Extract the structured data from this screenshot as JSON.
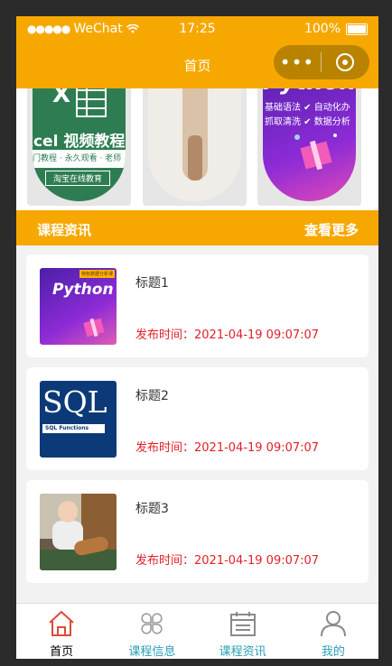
{
  "status": {
    "signal": "●●●●●",
    "carrier": "WeChat",
    "time": "17:25",
    "battery": "100%"
  },
  "nav": {
    "title": "首页",
    "more": "•••"
  },
  "banner": {
    "excel": {
      "icon_letter": "X",
      "title": "xcel 视频教程",
      "subtitle": "门教程 · 永久观看 · 老师",
      "shop": "淘宝在线教育"
    },
    "python": {
      "title": "Python",
      "row1": "基础语法   ✔ 自动化办",
      "row2": "抓取清洗   ✔ 数据分析"
    }
  },
  "section": {
    "title": "课程资讯",
    "more": "查看更多"
  },
  "news": [
    {
      "title": "标题1",
      "time": "发布时间：2021-04-19 09:07:07",
      "thumb": "python-course",
      "thumb_text": "Python",
      "thumb_tag": "特色数据分析课"
    },
    {
      "title": "标题2",
      "time": "发布时间：2021-04-19 09:07:07",
      "thumb": "sql-course",
      "thumb_text": "SQL",
      "thumb_sub": "SQL Functions"
    },
    {
      "title": "标题3",
      "time": "发布时间：2021-04-19 09:07:07",
      "thumb": "baby-guitar-photo"
    }
  ],
  "tabs": [
    {
      "label": "首页",
      "icon": "home-icon",
      "active": true
    },
    {
      "label": "课程信息",
      "icon": "clover-icon",
      "active": false
    },
    {
      "label": "课程资讯",
      "icon": "calendar-icon",
      "active": false
    },
    {
      "label": "我的",
      "icon": "user-icon",
      "active": false
    }
  ],
  "colors": {
    "accent": "#f7a800",
    "time_red": "#e0202a",
    "tab_teal": "#2aa0b8"
  }
}
